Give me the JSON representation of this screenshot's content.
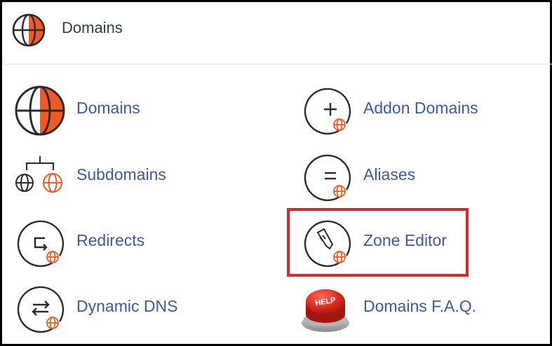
{
  "header": {
    "title": "Domains",
    "icon": "globe-icon"
  },
  "items": [
    {
      "label": "Domains",
      "icon": "globe-icon"
    },
    {
      "label": "Addon Domains",
      "icon": "addon-domains-icon"
    },
    {
      "label": "Subdomains",
      "icon": "subdomains-icon"
    },
    {
      "label": "Aliases",
      "icon": "aliases-icon"
    },
    {
      "label": "Redirects",
      "icon": "redirects-icon"
    },
    {
      "label": "Zone Editor",
      "icon": "zone-editor-icon"
    },
    {
      "label": "Dynamic DNS",
      "icon": "dynamic-dns-icon"
    },
    {
      "label": "Domains F.A.Q.",
      "icon": "help-button-icon",
      "icon_text": "HELP"
    }
  ],
  "colors": {
    "accent_orange": "#f05a24",
    "link_blue": "#3d5a9e",
    "highlight_red": "#d7262c",
    "icon_dark": "#2b2b2b"
  }
}
